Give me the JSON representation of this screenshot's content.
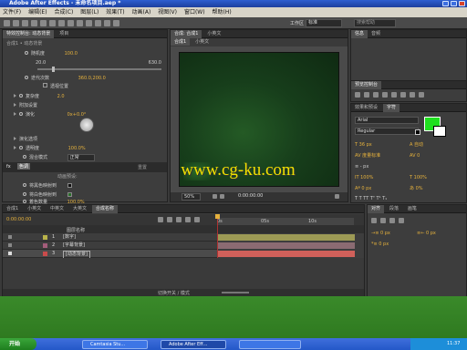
{
  "window": {
    "title": "Adobe After Effects - 未命名项目.aep *"
  },
  "menu": [
    "文件(F)",
    "编辑(E)",
    "合成(C)",
    "图层(L)",
    "效果(T)",
    "动画(A)",
    "视图(V)",
    "窗口(W)",
    "帮助(H)"
  ],
  "toolbar": {
    "workspace_label": "工作区",
    "workspace_value": "标准",
    "search_placeholder": "搜索帮助"
  },
  "effects_panel": {
    "tabs": [
      "特效控制台: 动态背景",
      "项目"
    ],
    "header": "合成1 • 动态背景",
    "rows": [
      {
        "label": "随机度",
        "value": "100.0"
      },
      {
        "label": "20.0",
        "value": "630.0"
      },
      {
        "label": "迭代次数",
        "value": ""
      },
      {
        "label": "",
        "value": ""
      },
      {
        "label": "复杂度",
        "value": "2.0"
      },
      {
        "label": "附加设置",
        "value": ""
      },
      {
        "label": "演化",
        "value": "0x+0.0°"
      },
      {
        "label": "演化选项",
        "value": ""
      },
      {
        "label": "透明度",
        "value": "100.0%"
      },
      {
        "label": "混合模式",
        "value": "正常"
      },
      {
        "label": "色调",
        "value": ""
      },
      {
        "label": "将黑色映射到",
        "value": ""
      },
      {
        "label": "将白色映射到",
        "value": ""
      },
      {
        "label": "着色数量",
        "value": "100.0%"
      }
    ]
  },
  "comp_panel": {
    "tabs": [
      "合成: 合成1",
      "小英文"
    ],
    "sub_tabs": [
      "合成1",
      "小英文"
    ],
    "watermark": "www.cg-ku.com",
    "zoom": "50%",
    "time": "0:00:00:00",
    "bg_color": "#173e1b"
  },
  "timeline": {
    "tabs": [
      "合成1",
      "小英文",
      "中英文",
      "大英文",
      "合成名称"
    ],
    "time": "0:00:00:00",
    "layer_column_header": "图层名称",
    "ruler_marks": [
      "0s",
      "05s",
      "10s"
    ],
    "layers": [
      {
        "num": "1",
        "name": "[数字]",
        "color": "#b9b34a"
      },
      {
        "num": "2",
        "name": "[字幕背景]",
        "color": "#a35d7a"
      },
      {
        "num": "3",
        "name": "[动态背景]",
        "color": "#c94b4b"
      }
    ],
    "footer": "切换开关 / 模式"
  },
  "right_panel": {
    "preview_tabs": [
      "预览控制台",
      "效果和预设"
    ],
    "char_tabs": [
      "字符",
      "段落"
    ],
    "font": "Arial",
    "font_style": "Regular",
    "fill_color": "#1fe01f",
    "para_tabs": [
      "对齐",
      "段落",
      "画笔"
    ]
  },
  "taskbar": {
    "start": "开始",
    "items": [
      "Camtasia Stu...",
      "Adobe After Eff...",
      ""
    ],
    "tray_text": "",
    "clock": "11:37"
  }
}
